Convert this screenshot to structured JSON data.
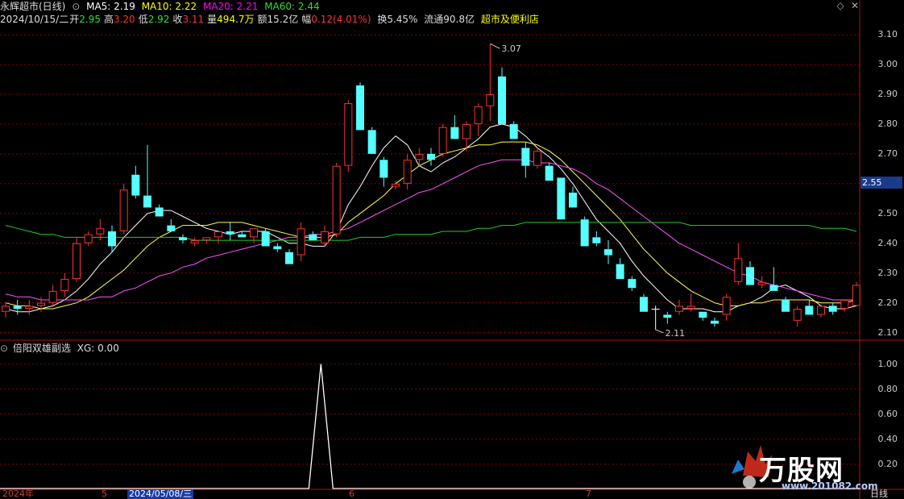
{
  "header": {
    "stock_title": "永辉超市(日线)",
    "ma5": "MA5: 2.19",
    "ma10": "MA10: 2.22",
    "ma20": "MA20: 2.21",
    "ma60": "MA60: 2.44",
    "date": "2024/10/15/二",
    "open_label": "开",
    "open": "2.95",
    "high_label": "高",
    "high": "3.20",
    "low_label": "低",
    "low": "2.92",
    "close_label": "收",
    "close": "3.11",
    "vol_label": "量",
    "vol": "494.7万",
    "amount_label": "额",
    "amount": "15.2亿",
    "chg_label": "幅",
    "chg": "0.12(4.01%)",
    "turnover": "换5.45%",
    "float_cap": "流通90.8亿",
    "sector": "超市及便利店"
  },
  "colors": {
    "up": "#ff3232",
    "down": "#54ffff",
    "ma5": "#ffffff",
    "ma10": "#ffff54",
    "ma20": "#ff54ff",
    "ma60": "#22cc22",
    "grid": "#8b0000"
  },
  "main_axis": {
    "ticks": [
      "3.10",
      "3.00",
      "2.90",
      "2.80",
      "2.70",
      "2.60",
      "2.50",
      "2.40",
      "2.30",
      "2.20",
      "2.10"
    ],
    "current_price": "2.55",
    "high_annot": "3.07",
    "low_annot": "2.11"
  },
  "sub_panel": {
    "title": "倍阳双雄副选",
    "value": "XG: 0.00",
    "ticks": [
      "1.00",
      "0.80",
      "0.60",
      "0.40",
      "0.20"
    ]
  },
  "bottom_axis": {
    "year": "2024年",
    "m5": "5",
    "cursor_date": "2024/05/08/三",
    "m6": "6",
    "m7": "7",
    "period": "日线"
  },
  "watermark": {
    "brand": "万股网",
    "url": "www.201082.com"
  },
  "chart_data": {
    "type": "candlestick",
    "ylim": [
      2.08,
      3.13
    ],
    "candles": [
      [
        2.17,
        2.2,
        2.15,
        2.19
      ],
      [
        2.19,
        2.21,
        2.16,
        2.18
      ],
      [
        2.18,
        2.21,
        2.16,
        2.19
      ],
      [
        2.19,
        2.22,
        2.17,
        2.2
      ],
      [
        2.2,
        2.26,
        2.19,
        2.24
      ],
      [
        2.24,
        2.3,
        2.22,
        2.28
      ],
      [
        2.28,
        2.42,
        2.27,
        2.4
      ],
      [
        2.4,
        2.44,
        2.39,
        2.43
      ],
      [
        2.43,
        2.48,
        2.41,
        2.45
      ],
      [
        2.44,
        2.46,
        2.37,
        2.39
      ],
      [
        2.44,
        2.6,
        2.43,
        2.58
      ],
      [
        2.63,
        2.66,
        2.55,
        2.56
      ],
      [
        2.56,
        2.73,
        2.52,
        2.52
      ],
      [
        2.52,
        2.53,
        2.49,
        2.49
      ],
      [
        2.46,
        2.48,
        2.44,
        2.44
      ],
      [
        2.42,
        2.43,
        2.4,
        2.41
      ],
      [
        2.4,
        2.42,
        2.39,
        2.41
      ],
      [
        2.41,
        2.42,
        2.4,
        2.42
      ],
      [
        2.42,
        2.44,
        2.4,
        2.44
      ],
      [
        2.44,
        2.47,
        2.41,
        2.43
      ],
      [
        2.43,
        2.44,
        2.42,
        2.42
      ],
      [
        2.42,
        2.45,
        2.4,
        2.45
      ],
      [
        2.44,
        2.45,
        2.39,
        2.39
      ],
      [
        2.39,
        2.4,
        2.37,
        2.38
      ],
      [
        2.37,
        2.38,
        2.33,
        2.33
      ],
      [
        2.36,
        2.47,
        2.34,
        2.45
      ],
      [
        2.43,
        2.44,
        2.41,
        2.41
      ],
      [
        2.4,
        2.46,
        2.39,
        2.44
      ],
      [
        2.43,
        2.67,
        2.42,
        2.66
      ],
      [
        2.66,
        2.88,
        2.64,
        2.87
      ],
      [
        2.93,
        2.94,
        2.78,
        2.78
      ],
      [
        2.78,
        2.79,
        2.7,
        2.7
      ],
      [
        2.68,
        2.69,
        2.59,
        2.62
      ],
      [
        2.59,
        2.61,
        2.58,
        2.6
      ],
      [
        2.6,
        2.7,
        2.58,
        2.68
      ],
      [
        2.68,
        2.72,
        2.66,
        2.7
      ],
      [
        2.7,
        2.72,
        2.66,
        2.68
      ],
      [
        2.7,
        2.8,
        2.69,
        2.79
      ],
      [
        2.79,
        2.83,
        2.75,
        2.75
      ],
      [
        2.75,
        2.81,
        2.71,
        2.8
      ],
      [
        2.8,
        2.87,
        2.76,
        2.86
      ],
      [
        2.86,
        3.07,
        2.81,
        2.9
      ],
      [
        2.96,
        2.99,
        2.8,
        2.8
      ],
      [
        2.8,
        2.81,
        2.75,
        2.75
      ],
      [
        2.72,
        2.74,
        2.62,
        2.66
      ],
      [
        2.66,
        2.72,
        2.65,
        2.71
      ],
      [
        2.66,
        2.67,
        2.61,
        2.61
      ],
      [
        2.62,
        2.62,
        2.48,
        2.48
      ],
      [
        2.57,
        2.59,
        2.52,
        2.52
      ],
      [
        2.48,
        2.49,
        2.39,
        2.39
      ],
      [
        2.42,
        2.44,
        2.39,
        2.4
      ],
      [
        2.38,
        2.41,
        2.33,
        2.36
      ],
      [
        2.33,
        2.35,
        2.28,
        2.28
      ],
      [
        2.28,
        2.29,
        2.24,
        2.25
      ],
      [
        2.22,
        2.23,
        2.17,
        2.17
      ],
      [
        2.18,
        2.19,
        2.11,
        2.18
      ],
      [
        2.16,
        2.17,
        2.13,
        2.15
      ],
      [
        2.17,
        2.21,
        2.16,
        2.19
      ],
      [
        2.18,
        2.23,
        2.17,
        2.19
      ],
      [
        2.17,
        2.17,
        2.14,
        2.15
      ],
      [
        2.14,
        2.15,
        2.12,
        2.13
      ],
      [
        2.16,
        2.23,
        2.14,
        2.22
      ],
      [
        2.27,
        2.4,
        2.26,
        2.35
      ],
      [
        2.32,
        2.34,
        2.26,
        2.26
      ],
      [
        2.26,
        2.29,
        2.25,
        2.27
      ],
      [
        2.26,
        2.32,
        2.24,
        2.24
      ],
      [
        2.21,
        2.22,
        2.17,
        2.17
      ],
      [
        2.14,
        2.19,
        2.12,
        2.18
      ],
      [
        2.19,
        2.21,
        2.16,
        2.16
      ],
      [
        2.16,
        2.19,
        2.15,
        2.19
      ],
      [
        2.19,
        2.2,
        2.16,
        2.17
      ],
      [
        2.18,
        2.21,
        2.17,
        2.21
      ],
      [
        2.19,
        2.27,
        2.19,
        2.26
      ]
    ],
    "ma_series": [
      {
        "name": "MA5",
        "values": [
          2.18,
          2.17,
          2.17,
          2.18,
          2.19,
          2.21,
          2.24,
          2.28,
          2.33,
          2.37,
          2.42,
          2.46,
          2.5,
          2.51,
          2.51,
          2.49,
          2.47,
          2.45,
          2.44,
          2.43,
          2.44,
          2.44,
          2.44,
          2.42,
          2.4,
          2.4,
          2.39,
          2.39,
          2.44,
          2.53,
          2.59,
          2.66,
          2.72,
          2.76,
          2.73,
          2.66,
          2.64,
          2.67,
          2.69,
          2.72,
          2.75,
          2.79,
          2.8,
          2.79,
          2.76,
          2.72,
          2.69,
          2.65,
          2.6,
          2.54,
          2.48,
          2.44,
          2.4,
          2.34,
          2.29,
          2.25,
          2.21,
          2.18,
          2.18,
          2.18,
          2.17,
          2.17,
          2.19,
          2.2,
          2.22,
          2.25,
          2.26,
          2.24,
          2.22,
          2.19,
          2.18,
          2.18,
          2.19
        ]
      },
      {
        "name": "MA10",
        "values": [
          2.2,
          2.19,
          2.19,
          2.18,
          2.18,
          2.19,
          2.2,
          2.22,
          2.25,
          2.28,
          2.31,
          2.35,
          2.39,
          2.42,
          2.44,
          2.46,
          2.46,
          2.46,
          2.47,
          2.47,
          2.47,
          2.46,
          2.45,
          2.44,
          2.43,
          2.42,
          2.42,
          2.42,
          2.43,
          2.47,
          2.5,
          2.53,
          2.56,
          2.6,
          2.63,
          2.66,
          2.68,
          2.7,
          2.71,
          2.72,
          2.73,
          2.73,
          2.74,
          2.74,
          2.74,
          2.73,
          2.71,
          2.68,
          2.64,
          2.6,
          2.56,
          2.52,
          2.48,
          2.43,
          2.38,
          2.34,
          2.3,
          2.27,
          2.24,
          2.22,
          2.2,
          2.19,
          2.19,
          2.2,
          2.2,
          2.21,
          2.21,
          2.21,
          2.21,
          2.2,
          2.2,
          2.2,
          2.21
        ]
      },
      {
        "name": "MA20",
        "values": [
          2.23,
          2.22,
          2.22,
          2.21,
          2.21,
          2.21,
          2.21,
          2.21,
          2.22,
          2.22,
          2.24,
          2.25,
          2.27,
          2.29,
          2.3,
          2.32,
          2.33,
          2.35,
          2.36,
          2.37,
          2.38,
          2.39,
          2.4,
          2.41,
          2.42,
          2.42,
          2.43,
          2.43,
          2.44,
          2.45,
          2.47,
          2.49,
          2.51,
          2.53,
          2.55,
          2.57,
          2.58,
          2.6,
          2.62,
          2.64,
          2.66,
          2.67,
          2.68,
          2.68,
          2.68,
          2.67,
          2.67,
          2.66,
          2.65,
          2.63,
          2.6,
          2.58,
          2.55,
          2.52,
          2.49,
          2.46,
          2.43,
          2.4,
          2.38,
          2.36,
          2.34,
          2.32,
          2.3,
          2.29,
          2.27,
          2.26,
          2.25,
          2.24,
          2.23,
          2.22,
          2.21,
          2.21,
          2.21
        ]
      },
      {
        "name": "MA60",
        "values": [
          2.46,
          2.45,
          2.44,
          2.43,
          2.43,
          2.42,
          2.42,
          2.42,
          2.42,
          2.42,
          2.42,
          2.42,
          2.42,
          2.42,
          2.42,
          2.42,
          2.41,
          2.41,
          2.41,
          2.41,
          2.41,
          2.41,
          2.41,
          2.41,
          2.41,
          2.41,
          2.41,
          2.41,
          2.41,
          2.41,
          2.42,
          2.42,
          2.42,
          2.43,
          2.43,
          2.43,
          2.43,
          2.44,
          2.44,
          2.44,
          2.45,
          2.45,
          2.46,
          2.46,
          2.47,
          2.47,
          2.47,
          2.47,
          2.47,
          2.47,
          2.47,
          2.47,
          2.47,
          2.47,
          2.47,
          2.47,
          2.47,
          2.47,
          2.46,
          2.46,
          2.46,
          2.46,
          2.46,
          2.46,
          2.46,
          2.46,
          2.46,
          2.46,
          2.46,
          2.45,
          2.45,
          2.45,
          2.44
        ]
      }
    ],
    "xg_signal": {
      "index_of_spike": 26,
      "value": 1.0
    }
  }
}
